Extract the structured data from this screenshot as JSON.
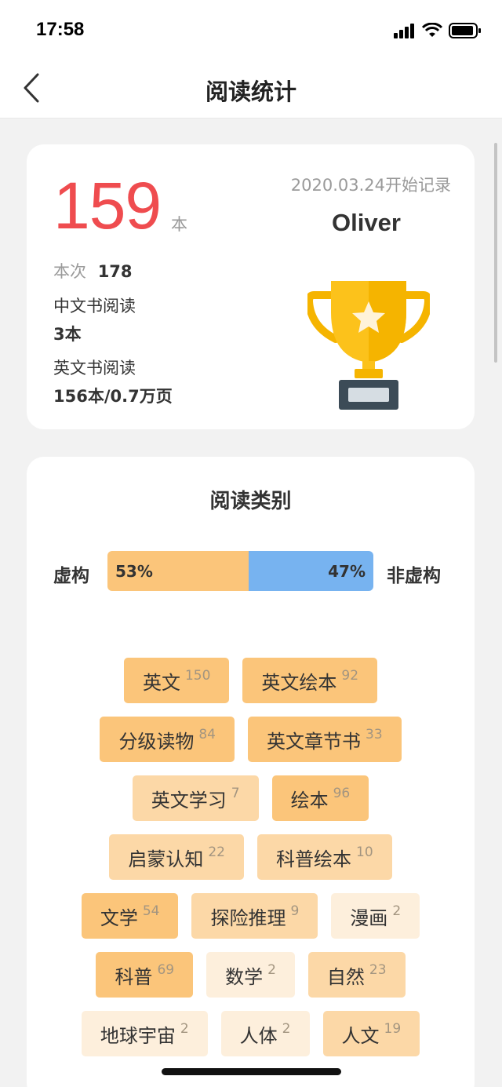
{
  "status_bar": {
    "time": "17:58"
  },
  "nav": {
    "title": "阅读统计"
  },
  "stats": {
    "total_count": "159",
    "total_unit": "本",
    "start_date": "2020.03.24开始记录",
    "user_name": "Oliver",
    "this_time_label": "本次",
    "this_time_value": "178",
    "chinese_label": "中文书阅读",
    "chinese_value": "3本",
    "english_label": "英文书阅读",
    "english_value": "156本/0.7万页"
  },
  "category": {
    "title": "阅读类别",
    "fiction_label": "虚构",
    "nonfiction_label": "非虚构",
    "fiction_percent": "53%",
    "nonfiction_percent": "47%",
    "fiction_fraction": 0.53,
    "tag_rows": [
      [
        {
          "label": "英文",
          "count": "150",
          "level": 1
        },
        {
          "label": "英文绘本",
          "count": "92",
          "level": 1
        }
      ],
      [
        {
          "label": "分级读物",
          "count": "84",
          "level": 1
        },
        {
          "label": "英文章节书",
          "count": "33",
          "level": 1
        }
      ],
      [
        {
          "label": "英文学习",
          "count": "7",
          "level": 2
        },
        {
          "label": "绘本",
          "count": "96",
          "level": 1
        }
      ],
      [
        {
          "label": "启蒙认知",
          "count": "22",
          "level": 2
        },
        {
          "label": "科普绘本",
          "count": "10",
          "level": 2
        }
      ],
      [
        {
          "label": "文学",
          "count": "54",
          "level": 1
        },
        {
          "label": "探险推理",
          "count": "9",
          "level": 2
        },
        {
          "label": "漫画",
          "count": "2",
          "level": 3
        }
      ],
      [
        {
          "label": "科普",
          "count": "69",
          "level": 1
        },
        {
          "label": "数学",
          "count": "2",
          "level": 3
        },
        {
          "label": "自然",
          "count": "23",
          "level": 2
        }
      ],
      [
        {
          "label": "地球宇宙",
          "count": "2",
          "level": 3
        },
        {
          "label": "人体",
          "count": "2",
          "level": 3
        },
        {
          "label": "人文",
          "count": "19",
          "level": 2
        }
      ]
    ]
  },
  "colors": {
    "accent_red": "#ef4c4f",
    "fiction": "#fbc57a",
    "nonfiction": "#77b3f0"
  }
}
